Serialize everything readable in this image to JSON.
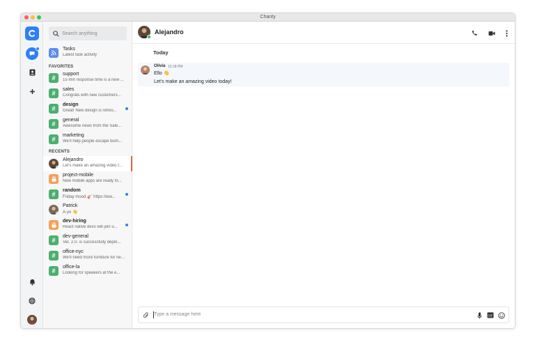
{
  "window": {
    "title": "Chanty"
  },
  "search": {
    "placeholder": "Search anything"
  },
  "tasks": {
    "name": "Tasks",
    "preview": "Latest task activity"
  },
  "sections": {
    "favorites": "FAVORITES",
    "recents": "RECENTS"
  },
  "favorites": [
    {
      "name": "support",
      "preview": "15 min response time is a new ...",
      "icon": "hash-icon",
      "unread": false
    },
    {
      "name": "sales",
      "preview": "Congrats with new customers...",
      "icon": "hash-icon",
      "unread": false
    },
    {
      "name": "design",
      "preview": "Great! New design is refres...",
      "icon": "hash-icon",
      "unread": true
    },
    {
      "name": "general",
      "preview": "Awesome news from the Sale...",
      "icon": "hash-icon",
      "unread": false
    },
    {
      "name": "marketing",
      "preview": "We'll help people escape burn...",
      "icon": "hash-icon",
      "unread": false
    }
  ],
  "recents": [
    {
      "name": "Alejandro",
      "preview": "Let's make an amazing video t...",
      "icon": "avatar",
      "unread": false,
      "active": true
    },
    {
      "name": "project-mobile",
      "preview": "New mobile apps are ready fo...",
      "icon": "lock-icon",
      "unread": false
    },
    {
      "name": "random",
      "preview": "Friday mood 🎸 https://ww...",
      "icon": "hash-icon",
      "unread": true
    },
    {
      "name": "Patrick",
      "preview": "A-yo 👋",
      "icon": "avatar",
      "unread": false
    },
    {
      "name": "dev-hiring",
      "preview": "React native devs will join u...",
      "icon": "lock-icon",
      "unread": true
    },
    {
      "name": "dev-general",
      "preview": "Ver. 2.0. is successfully deplo...",
      "icon": "hash-icon",
      "unread": false
    },
    {
      "name": "office-nyc",
      "preview": "We'll need more furniture for new...",
      "icon": "hash-icon",
      "unread": false
    },
    {
      "name": "office-la",
      "preview": "Looking for speakers at the e...",
      "icon": "hash-icon",
      "unread": false
    }
  ],
  "chat": {
    "contact": "Alejandro",
    "day": "Today",
    "message": {
      "author": "Olivia",
      "time": "12:18 PM",
      "line1": "Ello 👋",
      "line2": "Let's make an amazing video today!"
    }
  },
  "composer": {
    "placeholder": "Type a message here"
  },
  "colors": {
    "accent": "#2e80f5",
    "hash": "#4caf6e",
    "lock": "#f5a05a",
    "active_marker": "#e0603a"
  }
}
